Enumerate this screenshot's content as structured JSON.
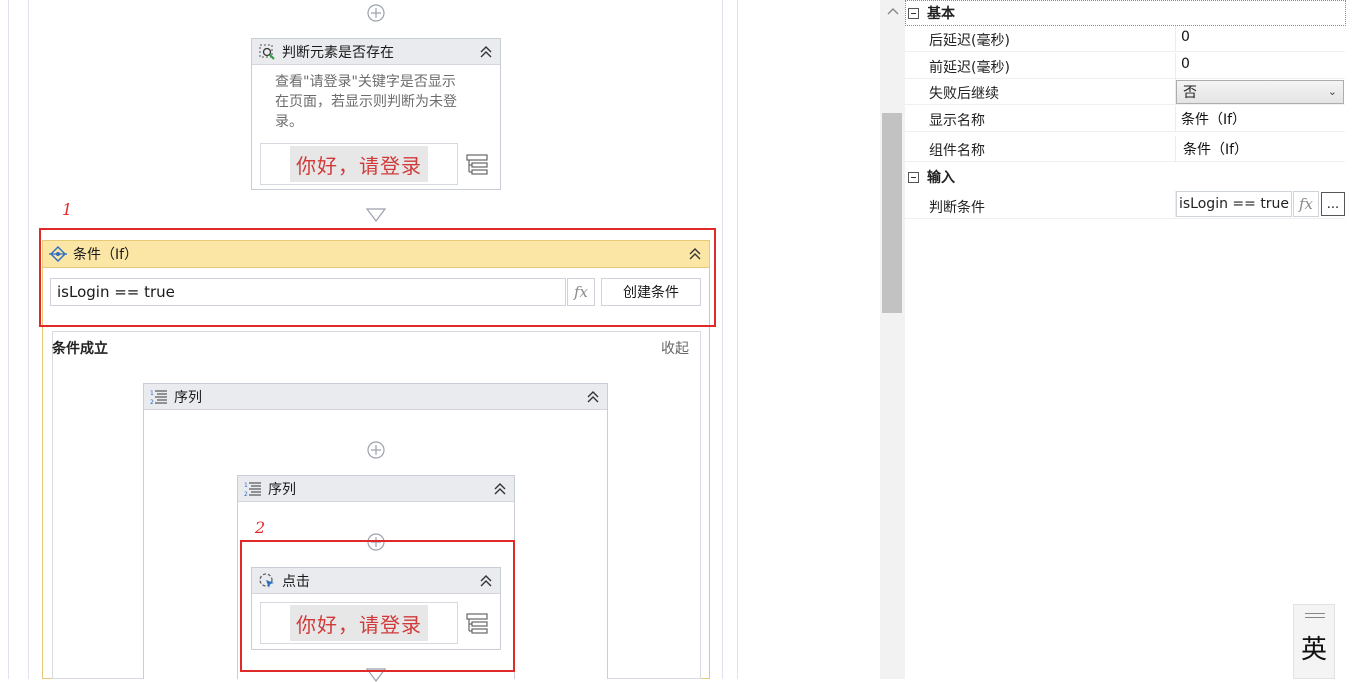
{
  "designer": {
    "find_element": {
      "title": "判断元素是否存在",
      "description_lines": [
        "查看\"请登录\"关键字是否显示",
        "在页面，若显示则判断为未登",
        "录。"
      ],
      "preview_text": "你好，请登录"
    },
    "markers": {
      "first": "1",
      "second": "2"
    },
    "if_activity": {
      "title": "条件（If）",
      "condition": "isLogin == true",
      "fx_label": "fx",
      "create_condition_label": "创建条件",
      "then_label": "条件成立",
      "collapse_label": "收起"
    },
    "outer_sequence": {
      "title": "序列"
    },
    "inner_sequence": {
      "title": "序列"
    },
    "click_activity": {
      "title": "点击",
      "preview_text": "你好，请登录"
    }
  },
  "properties": {
    "categories": {
      "basic": "基本",
      "input": "输入"
    },
    "rows": [
      {
        "name": "后延迟(毫秒)",
        "value": "0"
      },
      {
        "name": "前延迟(毫秒)",
        "value": "0"
      },
      {
        "name": "失败后继续",
        "value": "否"
      },
      {
        "name": "显示名称",
        "value": "条件（If）"
      },
      {
        "name": "组件名称",
        "value": "条件（If）"
      }
    ],
    "condition_row": {
      "name": "判断条件",
      "value": "isLogin == true",
      "fx_label": "fx",
      "more_label": "..."
    }
  },
  "ime": {
    "label": "英"
  }
}
